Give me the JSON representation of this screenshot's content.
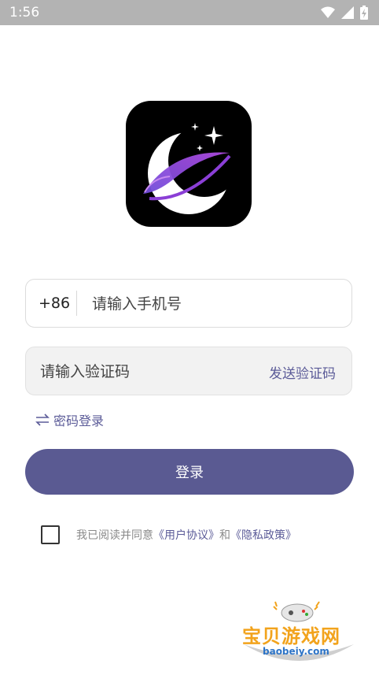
{
  "status_bar": {
    "time": "1:56"
  },
  "login": {
    "country_code": "+86",
    "phone_placeholder": "请输入手机号",
    "code_placeholder": "请输入验证码",
    "send_code_label": "发送验证码",
    "password_login_label": "密码登录",
    "submit_label": "登录"
  },
  "agreement": {
    "prefix": "我已阅读并同意",
    "user_agreement": "《用户协议》",
    "and": "和",
    "privacy_policy": "《隐私政策》",
    "checked": false
  },
  "watermark": {
    "title": "宝贝游戏网",
    "site": "baobeiy.com"
  },
  "colors": {
    "accent": "#5a5a92",
    "link": "#5b5b98",
    "status_bar": "#b3b3b3",
    "logo_bg": "#000000",
    "logo_swoosh": "#8b3fd6"
  }
}
